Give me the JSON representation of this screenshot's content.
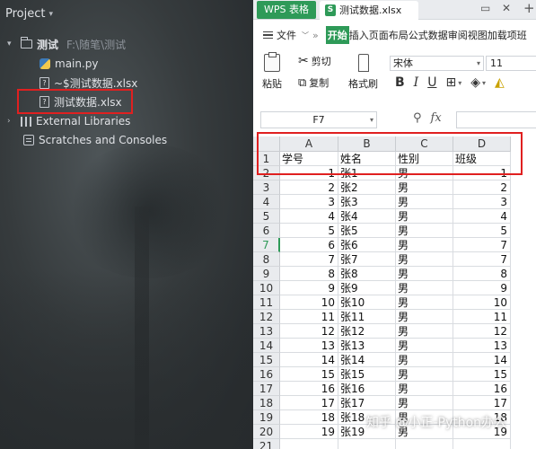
{
  "project": {
    "header": "Project",
    "root": {
      "name": "测试",
      "path": "F:\\随笔\\测试"
    },
    "files": [
      "main.py",
      "~$测试数据.xlsx",
      "测试数据.xlsx"
    ],
    "external_libraries": "External Libraries",
    "scratches": "Scratches and Consoles"
  },
  "wps": {
    "app_tab": "WPS 表格",
    "doc_tab": "测试数据.xlsx",
    "menu": {
      "file": "文件",
      "start": "开始",
      "items": "插入页面布局公式数据审阅视图加载项班"
    },
    "toolbar": {
      "paste": "粘贴",
      "cut": "剪切",
      "copy": "复制",
      "format_painter": "格式刷",
      "font": "宋体",
      "font_size": "11",
      "bold": "B",
      "italic": "I",
      "underline": "U"
    },
    "namebox": "F7",
    "fx": "fx",
    "columns": [
      "A",
      "B",
      "C",
      "D"
    ],
    "header_row": {
      "num": "1",
      "cells": [
        "学号",
        "姓名",
        "性别",
        "班级"
      ]
    },
    "rows": [
      {
        "num": "2",
        "a": "1",
        "b": "张1",
        "c": "男",
        "d": "1"
      },
      {
        "num": "3",
        "a": "2",
        "b": "张2",
        "c": "男",
        "d": "2"
      },
      {
        "num": "4",
        "a": "3",
        "b": "张3",
        "c": "男",
        "d": "3"
      },
      {
        "num": "5",
        "a": "4",
        "b": "张4",
        "c": "男",
        "d": "4"
      },
      {
        "num": "6",
        "a": "5",
        "b": "张5",
        "c": "男",
        "d": "5"
      },
      {
        "num": "7",
        "a": "6",
        "b": "张6",
        "c": "男",
        "d": "7"
      },
      {
        "num": "8",
        "a": "7",
        "b": "张7",
        "c": "男",
        "d": "7"
      },
      {
        "num": "9",
        "a": "8",
        "b": "张8",
        "c": "男",
        "d": "8"
      },
      {
        "num": "10",
        "a": "9",
        "b": "张9",
        "c": "男",
        "d": "9"
      },
      {
        "num": "11",
        "a": "10",
        "b": "张10",
        "c": "男",
        "d": "10"
      },
      {
        "num": "12",
        "a": "11",
        "b": "张11",
        "c": "男",
        "d": "11"
      },
      {
        "num": "13",
        "a": "12",
        "b": "张12",
        "c": "男",
        "d": "12"
      },
      {
        "num": "14",
        "a": "13",
        "b": "张13",
        "c": "男",
        "d": "13"
      },
      {
        "num": "15",
        "a": "14",
        "b": "张14",
        "c": "男",
        "d": "14"
      },
      {
        "num": "16",
        "a": "15",
        "b": "张15",
        "c": "男",
        "d": "15"
      },
      {
        "num": "17",
        "a": "16",
        "b": "张16",
        "c": "男",
        "d": "16"
      },
      {
        "num": "18",
        "a": "17",
        "b": "张17",
        "c": "男",
        "d": "17"
      },
      {
        "num": "19",
        "a": "18",
        "b": "张18",
        "c": "男",
        "d": "18"
      },
      {
        "num": "20",
        "a": "19",
        "b": "张19",
        "c": "男",
        "d": "19"
      },
      {
        "num": "21",
        "a": "",
        "b": "",
        "c": "",
        "d": ""
      }
    ],
    "active_row": "7"
  },
  "watermark": "知乎 @小正-Python办公",
  "colors": {
    "accent": "#2e9a58",
    "highlight": "#e02020",
    "project_text": "#dfe1e5"
  }
}
